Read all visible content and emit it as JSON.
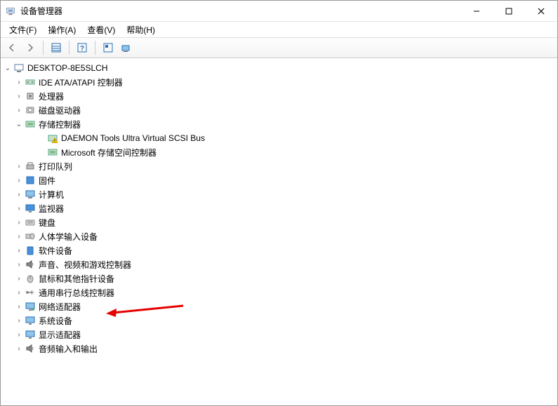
{
  "title": "设备管理器",
  "menus": {
    "file": "文件(F)",
    "action": "操作(A)",
    "view": "查看(V)",
    "help": "帮助(H)"
  },
  "root": "DESKTOP-8E5SLCH",
  "categories": {
    "ide": "IDE ATA/ATAPI 控制器",
    "cpu": "处理器",
    "disk": "磁盘驱动器",
    "storage": "存储控制器",
    "daemon": "DAEMON Tools Ultra Virtual SCSI Bus",
    "msstorage": "Microsoft 存储空间控制器",
    "printq": "打印队列",
    "firmware": "固件",
    "computer": "计算机",
    "monitor": "监视器",
    "keyboard": "键盘",
    "hid": "人体学输入设备",
    "softdev": "软件设备",
    "sound": "声音、视频和游戏控制器",
    "mouse": "鼠标和其他指针设备",
    "usb": "通用串行总线控制器",
    "network": "网络适配器",
    "system": "系统设备",
    "display": "显示适配器",
    "audio": "音频输入和输出"
  }
}
